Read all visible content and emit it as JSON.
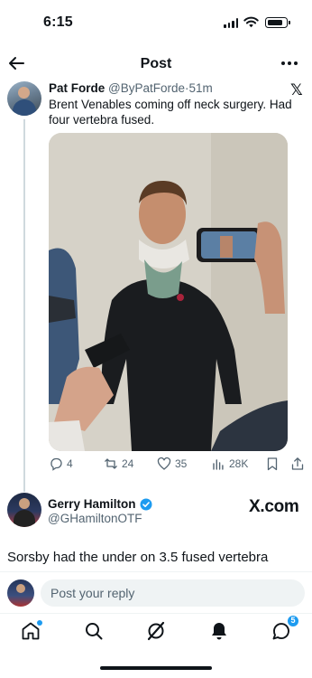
{
  "status_bar": {
    "time": "6:15"
  },
  "header": {
    "title": "Post"
  },
  "tweet": {
    "author_name": "Pat Forde",
    "author_handle": "@ByPatForde",
    "time_ago": "51m",
    "text": "Brent Venables coming off neck surgery. Had four vertebra fused.",
    "stats": {
      "replies": "4",
      "reposts": "24",
      "likes": "35",
      "views": "28K"
    }
  },
  "embedded": {
    "author_name": "Gerry Hamilton",
    "author_handle": "@GHamiltonOTF",
    "source_logo": "X.com",
    "text": "Sorsby had the under on 3.5 fused vertebra"
  },
  "reply": {
    "placeholder": "Post your reply"
  },
  "tabbar": {
    "messages_badge": "5"
  },
  "colors": {
    "accent": "#1d9bf0",
    "text": "#0f1419",
    "muted": "#536471",
    "divider": "#eff3f4"
  }
}
